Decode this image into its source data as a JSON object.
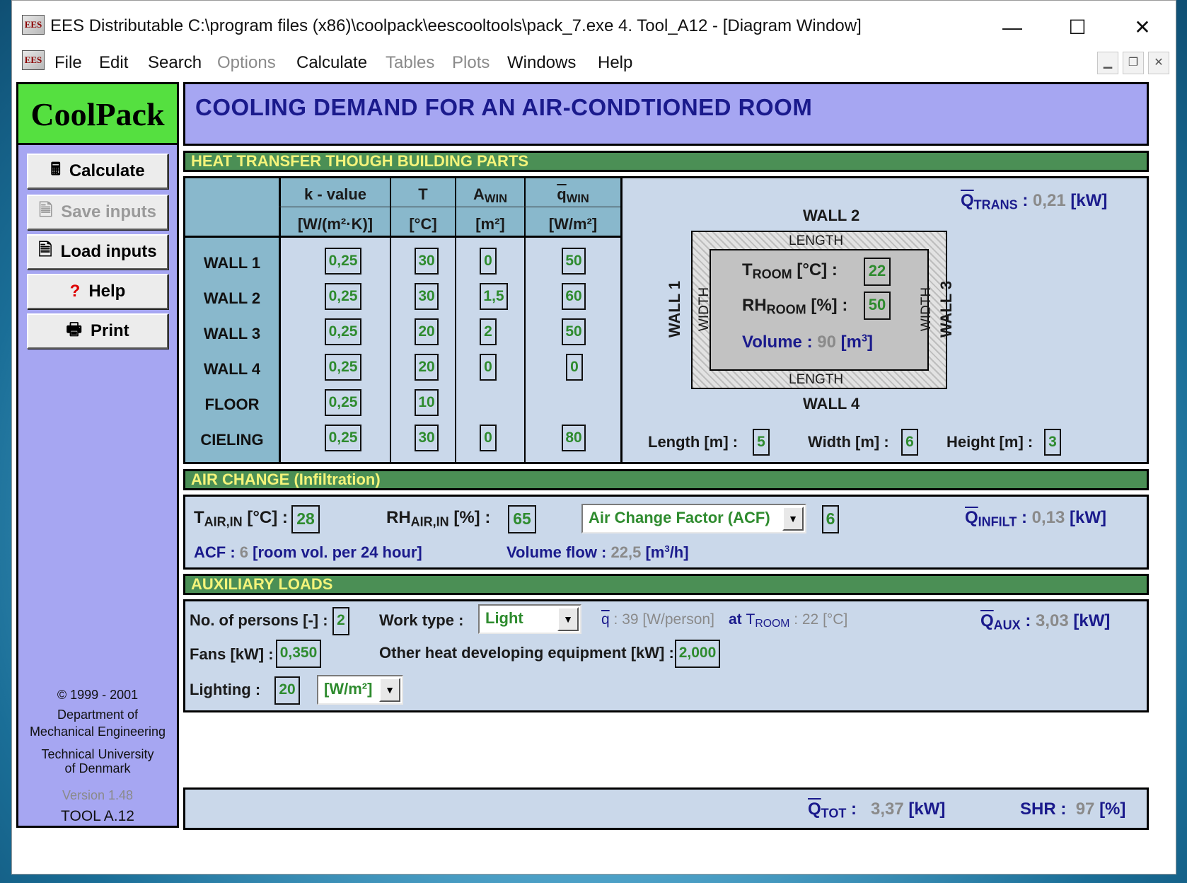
{
  "window": {
    "title": "EES Distributable  C:\\program files (x86)\\coolpack\\eescooltools\\pack_7.exe   4. Tool_A12 - [Diagram Window]",
    "app_icon": "EES"
  },
  "menu": [
    "File",
    "Edit",
    "Search",
    "Options",
    "Calculate",
    "Tables",
    "Plots",
    "Windows",
    "Help"
  ],
  "menu_disabled": [
    "Options",
    "Tables",
    "Plots"
  ],
  "sidebar": {
    "logo": "CoolPack",
    "buttons": {
      "calculate": "Calculate",
      "save": "Save inputs",
      "load": "Load inputs",
      "help": "Help",
      "print": "Print"
    },
    "copyright": "© 1999 - 2001",
    "dept1": "Department of",
    "dept2": "Mechanical Engineering",
    "univ1": "Technical University",
    "univ2": "of Denmark",
    "version": "Version 1.48",
    "tool": "TOOL A.12"
  },
  "header": {
    "title": "COOLING DEMAND FOR AN AIR-CONDTIONED ROOM"
  },
  "heat_transfer": {
    "section_title": "HEAT TRANSFER THOUGH BUILDING PARTS",
    "col_k": "k - value",
    "col_t": "T",
    "col_a": "A",
    "col_a_sub": "WIN",
    "col_q": "q",
    "col_q_sub": "WIN",
    "unit_k": "[W/(m²·K)]",
    "unit_t": "[°C]",
    "unit_a": "[m²]",
    "unit_q": "[W/m²]",
    "rows": [
      {
        "label": "WALL 1",
        "k": "0,25",
        "t": "30",
        "a": "0",
        "q": "50"
      },
      {
        "label": "WALL 2",
        "k": "0,25",
        "t": "30",
        "a": "1,5",
        "q": "60"
      },
      {
        "label": "WALL 3",
        "k": "0,25",
        "t": "20",
        "a": "2",
        "q": "50"
      },
      {
        "label": "WALL 4",
        "k": "0,25",
        "t": "20",
        "a": "0",
        "q": "0"
      },
      {
        "label": "FLOOR",
        "k": "0,25",
        "t": "10",
        "a": "",
        "q": ""
      },
      {
        "label": "CIELING",
        "k": "0,25",
        "t": "30",
        "a": "0",
        "q": "80"
      }
    ],
    "qtrans_label": "Q",
    "qtrans_sub": "TRANS",
    "qtrans_value": "0,21",
    "qtrans_unit": "[kW]",
    "room": {
      "wall1": "WALL 1",
      "wall2": "WALL 2",
      "wall3": "WALL 3",
      "wall4": "WALL 4",
      "length": "LENGTH",
      "width": "WIDTH",
      "troom_label": "T",
      "troom_sub": "ROOM",
      "troom_unit": "[°C] :",
      "troom_value": "22",
      "rh_label": "RH",
      "rh_sub": "ROOM",
      "rh_unit": "[%] :",
      "rh_value": "50",
      "volume_label": "Volume :",
      "volume_value": "90",
      "volume_unit": "[m",
      "volume_sup": "3",
      "volume_close": "]"
    },
    "dims": {
      "length_label": "Length [m] :",
      "length_value": "5",
      "width_label": "Width [m] :",
      "width_value": "6",
      "height_label": "Height [m] :",
      "height_value": "3"
    }
  },
  "air_change": {
    "section_title": "AIR CHANGE (Infiltration)",
    "tair_label": "T",
    "tair_sub": "AIR,IN",
    "tair_unit": "[°C] :",
    "tair_value": "28",
    "rh_label": "RH",
    "rh_sub": "AIR,IN",
    "rh_unit": "[%] :",
    "rh_value": "65",
    "method_selected": "Air Change Factor (ACF)",
    "factor_value": "6",
    "qinfilt_label": "Q",
    "qinfilt_sub": "INFILT",
    "qinfilt_value": "0,13",
    "qinfilt_unit": "[kW]",
    "acf_label": "ACF :",
    "acf_value": "6",
    "acf_unit": "[room vol. per 24 hour]",
    "flow_label": "Volume flow :",
    "flow_value": "22,5",
    "flow_unit": "[m",
    "flow_sup": "3",
    "flow_close": "/h]"
  },
  "aux": {
    "section_title": "AUXILIARY LOADS",
    "persons_label": "No. of persons [-] :",
    "persons_value": "2",
    "work_label": "Work type :",
    "work_selected": "Light",
    "q_label": "q",
    "q_value": ": 39 [W/person]",
    "at_label": "at",
    "at_t": "T",
    "at_sub": "ROOM",
    "at_value": ": 22 [°C]",
    "qaux_label": "Q",
    "qaux_sub": "AUX",
    "qaux_value": "3,03",
    "qaux_unit": "[kW]",
    "fans_label": "Fans [kW] :",
    "fans_value": "0,350",
    "other_label": "Other heat developing equipment [kW] :",
    "other_value": "2,000",
    "lighting_label": "Lighting :",
    "lighting_value": "20",
    "lighting_unit_selected": "[W/m²]"
  },
  "totals": {
    "qtot_label": "Q",
    "qtot_sub": "TOT",
    "qtot_value": "3,37",
    "qtot_unit": "[kW]",
    "shr_label": "SHR :",
    "shr_value": "97",
    "shr_unit": "[%]"
  },
  "colors": {
    "panel_blue": "#cad8ea",
    "header_purple": "#a6a6f2",
    "section_green": "#4b8f55",
    "logo_green": "#55e040",
    "input_text_green": "#2e8b2e",
    "label_navy": "#1a1a8c"
  }
}
